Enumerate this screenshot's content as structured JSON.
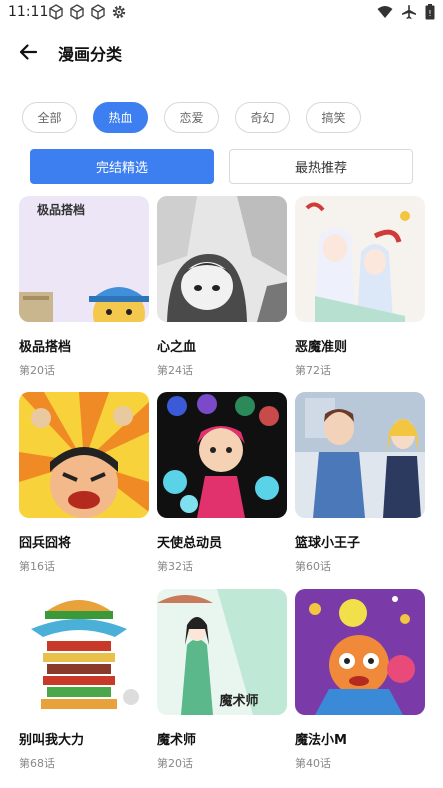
{
  "status": {
    "time": "11:11",
    "left_icons": [
      "cube-icon",
      "cube-icon",
      "cube-icon",
      "gear-icon"
    ],
    "right_icons": [
      "wifi-icon",
      "airplane-icon",
      "battery-icon"
    ]
  },
  "header": {
    "back_icon": "arrow-left-icon",
    "title": "漫画分类"
  },
  "categories": [
    {
      "label": "全部",
      "active": false
    },
    {
      "label": "热血",
      "active": true
    },
    {
      "label": "恋爱",
      "active": false
    },
    {
      "label": "奇幻",
      "active": false
    },
    {
      "label": "搞笑",
      "active": false
    }
  ],
  "segments": {
    "left": "完结精选",
    "right": "最热推荐"
  },
  "comics": [
    {
      "title": "极品搭档",
      "episode": "第20话",
      "cover_text": "极品搭档"
    },
    {
      "title": "心之血",
      "episode": "第24话"
    },
    {
      "title": "恶魔准则",
      "episode": "第72话"
    },
    {
      "title": "囧兵囧将",
      "episode": "第16话"
    },
    {
      "title": "天使总动员",
      "episode": "第32话"
    },
    {
      "title": "篮球小王子",
      "episode": "第60话"
    },
    {
      "title": "别叫我大力",
      "episode": "第68话"
    },
    {
      "title": "魔术师",
      "episode": "第20话",
      "cover_text": "魔术师"
    },
    {
      "title": "魔法小M",
      "episode": "第40话"
    }
  ],
  "colors": {
    "accent": "#3d7ff0"
  }
}
